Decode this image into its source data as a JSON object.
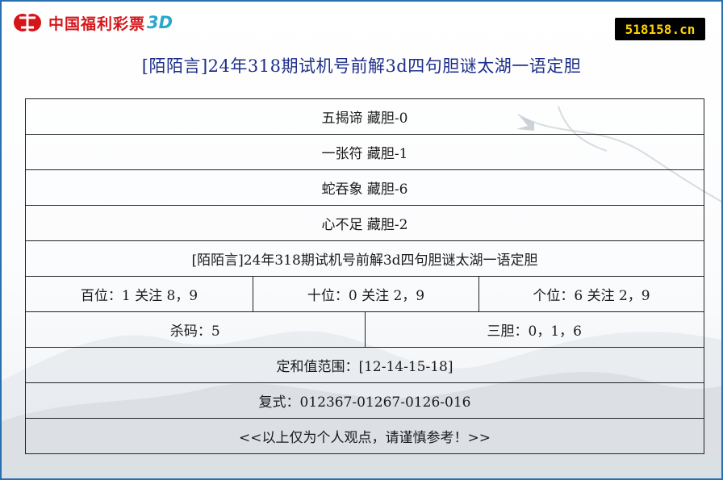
{
  "logo": {
    "brand_text": "中国福利彩票",
    "brand_3d": "3D"
  },
  "site_badge": "518158.cn",
  "page_title": "[陌陌言]24年318期试机号前解3d四句胆谜太湖一语定胆",
  "riddles": [
    {
      "text": "五揭谛 藏胆-0"
    },
    {
      "text": "一张符 藏胆-1"
    },
    {
      "text": "蛇吞象 藏胆-6"
    },
    {
      "text": "心不足 藏胆-2"
    }
  ],
  "subtitle": "[陌陌言]24年318期试机号前解3d四句胆谜太湖一语定胆",
  "positions": {
    "hundreds": "百位：1 关注 8，9",
    "tens": "十位：0 关注 2，9",
    "units": "个位：6 关注 2，9"
  },
  "kill_code": "杀码：5",
  "three_dan": "三胆：0，1，6",
  "sum_range": "定和值范围：[12-14-15-18]",
  "compound": "复式：012367-01267-0126-016",
  "disclaimer": "<<以上仅为个人观点，请谨慎参考！>>",
  "colors": {
    "border": "#2a6fb0",
    "title": "#1e2f8a",
    "badge_bg": "#000000",
    "badge_text": "#ffd400",
    "logo_red": "#d6151a",
    "logo_3d": "#2aa7c9"
  }
}
